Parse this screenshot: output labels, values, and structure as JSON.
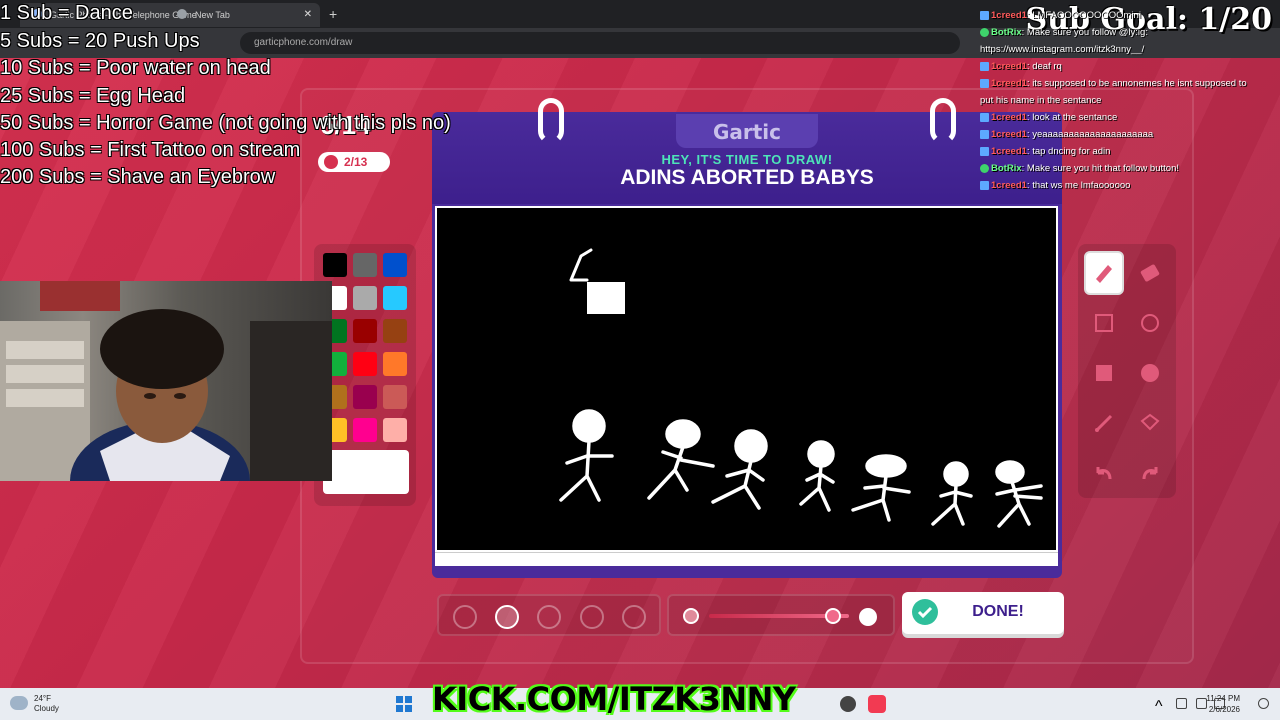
{
  "browser": {
    "tabs": [
      {
        "label": "Gartic Phone - The Telephone Game",
        "active": true
      },
      {
        "label": "New Tab",
        "active": false
      }
    ],
    "address": "garticphone.com/draw"
  },
  "sub_goals": [
    "1 Sub = Dance",
    "5 Subs = 20 Push Ups",
    "10 Subs =  Poor water on head",
    "25 Subs = Egg Head",
    "50 Subs =  Horror Game (not going with this pls no)",
    "100 Subs = First Tattoo on stream",
    "200 Subs =  Shave an Eyebrow"
  ],
  "game": {
    "round": "6/14",
    "score": "2/13",
    "logo": "Gartic",
    "prompt_heading": "HEY, IT'S TIME TO DRAW!",
    "prompt_word": "ADINS ABORTED BABYS",
    "done_label": "DONE!",
    "brush_size_selected": 2,
    "opacity_level": 0.83
  },
  "palette_colors": [
    "#000000",
    "#666666",
    "#0050cd",
    "#ffffff",
    "#aaaaaa",
    "#26c9ff",
    "#017420",
    "#990000",
    "#964112",
    "#11b03c",
    "#ff0013",
    "#ff7829",
    "#b0701c",
    "#99004e",
    "#cb5a57",
    "#ffc126",
    "#ff008f",
    "#feafa8"
  ],
  "tools": [
    {
      "name": "pen-icon",
      "active": true
    },
    {
      "name": "eraser-icon",
      "active": false
    },
    {
      "name": "square-outline-icon",
      "active": false
    },
    {
      "name": "circle-outline-icon",
      "active": false
    },
    {
      "name": "square-filled-icon",
      "active": false
    },
    {
      "name": "circle-filled-icon",
      "active": false
    },
    {
      "name": "line-icon",
      "active": false
    },
    {
      "name": "fill-bucket-icon",
      "active": false
    },
    {
      "name": "undo-icon",
      "active": false
    },
    {
      "name": "redo-icon",
      "active": false
    }
  ],
  "chat": {
    "sub_goal": "Sub Goal: 1/20",
    "messages": [
      {
        "user": "1creed1",
        "text": ": LMFAOOOOOOOOOmini",
        "bot": false
      },
      {
        "user": "BotRix",
        "text": ": Make sure you follow @ly:ig:",
        "bot": true
      },
      {
        "user": "",
        "text": "https://www.instagram.com/itzk3nny__/",
        "bot": false
      },
      {
        "user": "1creed1",
        "text": ": deaf rq",
        "bot": false
      },
      {
        "user": "1creed1",
        "text": ": its supposed to be annonemes he isnt supposed to",
        "bot": false
      },
      {
        "user": "",
        "text": "put his name in the sentance",
        "bot": false
      },
      {
        "user": "1creed1",
        "text": ": look at the sentance",
        "bot": false
      },
      {
        "user": "1creed1",
        "text": ": yeaaaaaaaaaaaaaaaaaaaaa",
        "bot": false
      },
      {
        "user": "1creed1",
        "text": ": tap dncing for adin",
        "bot": false
      },
      {
        "user": "BotRix",
        "text": ": Make sure you hit that follow button!",
        "bot": true
      },
      {
        "user": "1creed1",
        "text": ": that ws me lmfaoooooo",
        "bot": false
      }
    ]
  },
  "overlay": {
    "kick_url": "KICK.COM/ITZK3NNY"
  },
  "taskbar": {
    "temperature": "24°F",
    "weather": "Cloudy",
    "time": "11:24 PM",
    "date": "2/6/2026"
  }
}
